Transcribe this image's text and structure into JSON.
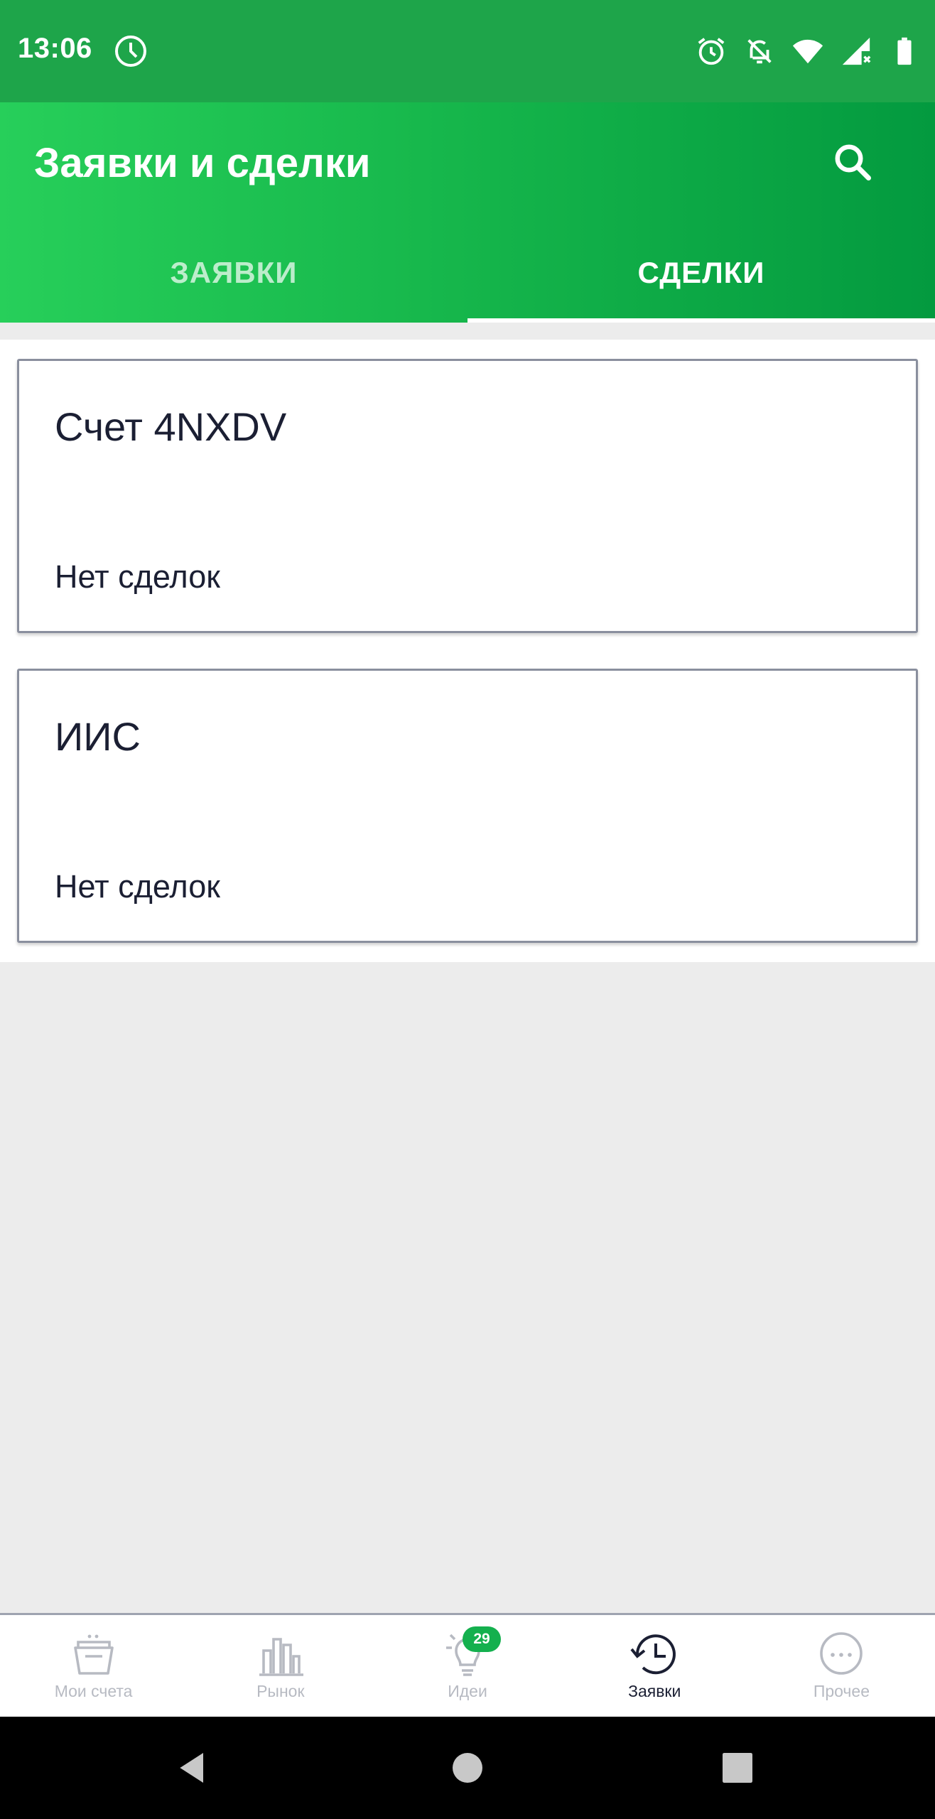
{
  "status_bar": {
    "time": "13:06",
    "icons": [
      "clock-icon",
      "alarm-icon",
      "notifications-off-icon",
      "wifi-icon",
      "signal-icon",
      "battery-icon"
    ]
  },
  "app_bar": {
    "title": "Заявки и сделки",
    "search_icon": "search-icon",
    "gradient": [
      "#27cf5a",
      "#039a3f"
    ]
  },
  "tabs": [
    {
      "label": "ЗАЯВКИ",
      "active": false
    },
    {
      "label": "СДЕЛКИ",
      "active": true
    }
  ],
  "cards": [
    {
      "title": "Счет 4NXDV",
      "subtitle": "Нет сделок"
    },
    {
      "title": "ИИС",
      "subtitle": "Нет сделок"
    }
  ],
  "bottom_nav": {
    "items": [
      {
        "label": "Мои счета",
        "icon": "wallet-icon",
        "active": false
      },
      {
        "label": "Рынок",
        "icon": "market-chart-icon",
        "active": false
      },
      {
        "label": "Идеи",
        "icon": "lightbulb-icon",
        "active": false,
        "badge": "29"
      },
      {
        "label": "Заявки",
        "icon": "history-clock-icon",
        "active": true
      },
      {
        "label": "Прочее",
        "icon": "more-icon",
        "active": false
      }
    ]
  },
  "colors": {
    "accent_green": "#14b04e",
    "status_bar": "#1ea54a",
    "text_dark": "#1b1f33",
    "inactive_nav": "#b7bac2"
  }
}
